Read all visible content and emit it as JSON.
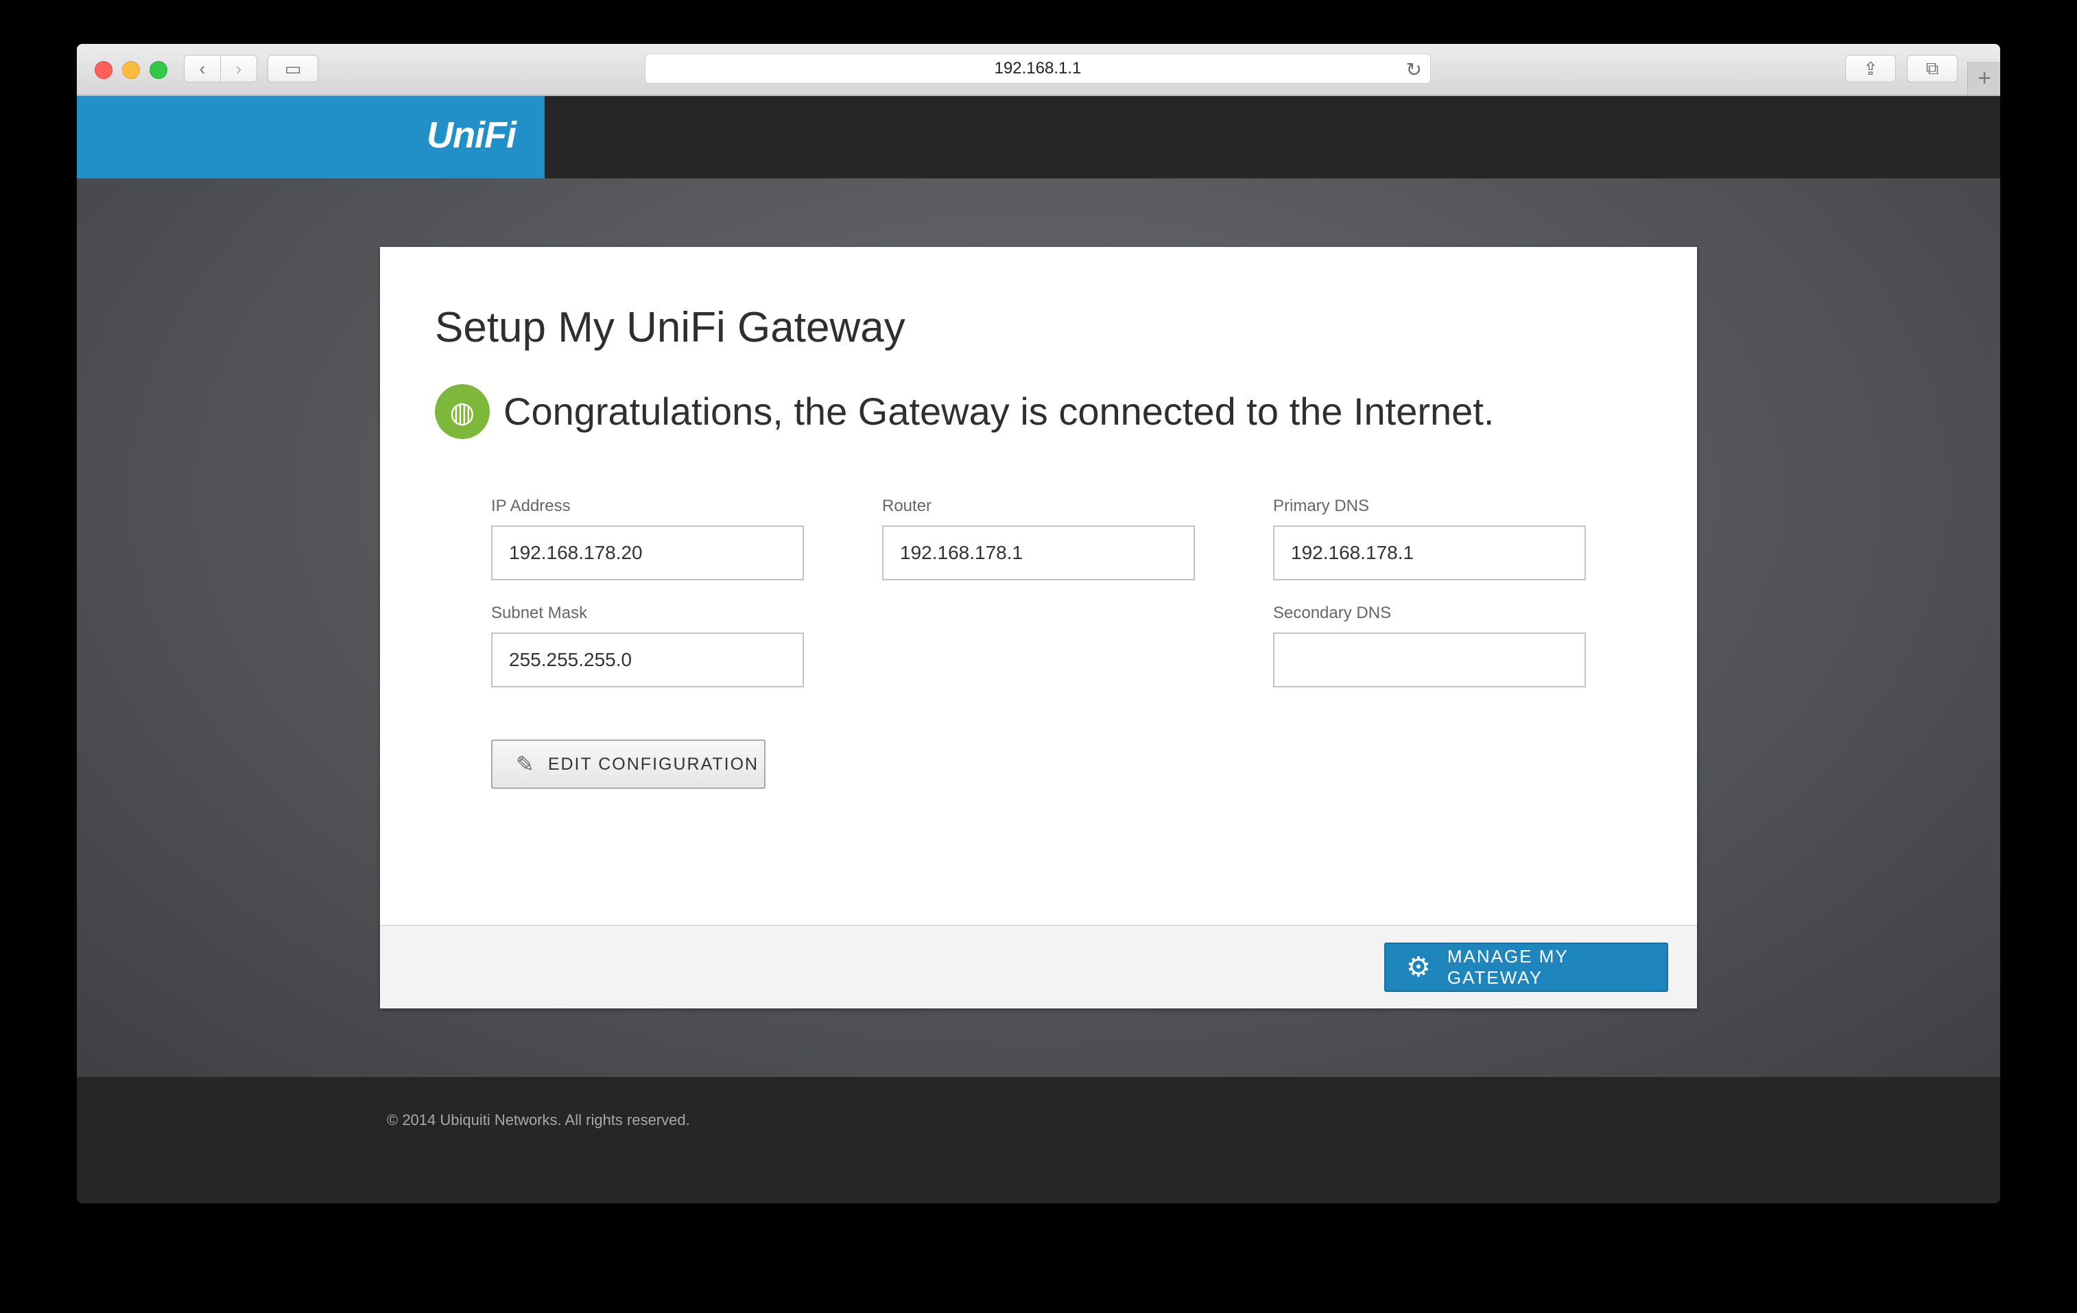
{
  "browser": {
    "url": "192.168.1.1",
    "back_icon": "‹",
    "forward_icon": "›",
    "reload_icon": "↻",
    "share_icon": "⇪",
    "tabs_icon": "⧉",
    "newtab_icon": "+",
    "sidebar_icon": "▭"
  },
  "header": {
    "brand": "UniFi"
  },
  "setup": {
    "title": "Setup My UniFi Gateway",
    "status_message": "Congratulations, the Gateway is connected to the Internet.",
    "fields": {
      "ip_address": {
        "label": "IP Address",
        "value": "192.168.178.20"
      },
      "router": {
        "label": "Router",
        "value": "192.168.178.1"
      },
      "primary_dns": {
        "label": "Primary DNS",
        "value": "192.168.178.1"
      },
      "subnet_mask": {
        "label": "Subnet Mask",
        "value": "255.255.255.0"
      },
      "secondary_dns": {
        "label": "Secondary DNS",
        "value": ""
      }
    },
    "edit_button": "EDIT CONFIGURATION",
    "manage_button": "MANAGE MY GATEWAY"
  },
  "footer": {
    "copyright": "© 2014 Ubiquiti Networks. All rights reserved."
  },
  "colors": {
    "brand_blue": "#2190c8",
    "success_green": "#7db83b",
    "primary_button": "#1f86bd"
  }
}
